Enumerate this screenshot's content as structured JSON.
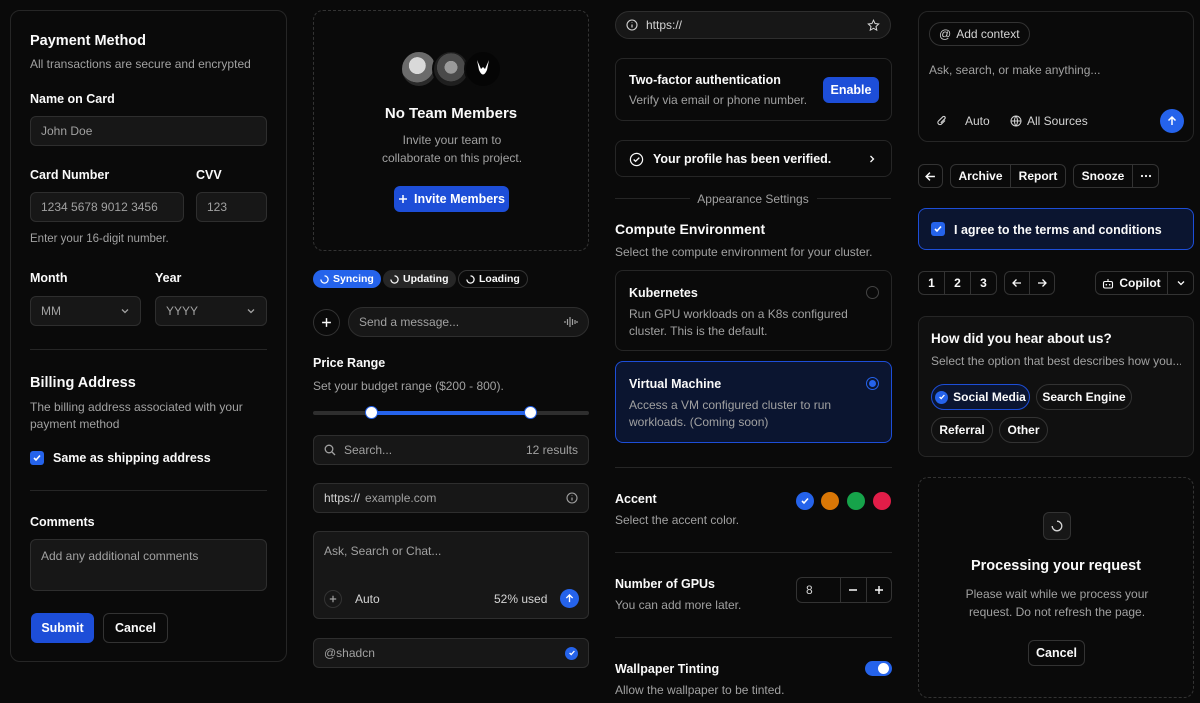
{
  "payment": {
    "title": "Payment Method",
    "subtitle": "All transactions are secure and encrypted",
    "name_label": "Name on Card",
    "name_placeholder": "John Doe",
    "card_label": "Card Number",
    "card_placeholder": "1234 5678 9012 3456",
    "cvv_label": "CVV",
    "cvv_placeholder": "123",
    "card_hint": "Enter your 16-digit number.",
    "month_label": "Month",
    "month_value": "MM",
    "year_label": "Year",
    "year_value": "YYYY",
    "billing_title": "Billing Address",
    "billing_desc": "The billing address associated with your payment method",
    "same_shipping": "Same as shipping address",
    "comments_label": "Comments",
    "comments_placeholder": "Add any additional comments",
    "submit": "Submit",
    "cancel": "Cancel"
  },
  "team": {
    "title": "No Team Members",
    "desc": "Invite your team to collaborate on this project.",
    "invite": "Invite Members"
  },
  "badges": [
    "Syncing",
    "Updating",
    "Loading"
  ],
  "message": {
    "placeholder": "Send a message..."
  },
  "price": {
    "title": "Price Range",
    "desc": "Set your budget range ($200 - 800).",
    "min_fraction": 0.2,
    "max_fraction": 0.8
  },
  "search": {
    "placeholder": "Search...",
    "results": "12 results"
  },
  "url_input": {
    "prefix": "https://",
    "placeholder": "example.com"
  },
  "chat": {
    "placeholder": "Ask, Search or Chat...",
    "mode": "Auto",
    "usage": "52% used"
  },
  "username": {
    "value": "@shadcn"
  },
  "browser": {
    "url": "https://"
  },
  "twofa": {
    "title": "Two-factor authentication",
    "desc": "Verify via email or phone number.",
    "button": "Enable"
  },
  "verified": {
    "text": "Your profile has been verified."
  },
  "appearance": {
    "label": "Appearance Settings"
  },
  "compute": {
    "title": "Compute Environment",
    "desc": "Select the compute environment for your cluster.",
    "options": [
      {
        "title": "Kubernetes",
        "desc": "Run GPU workloads on a K8s configured cluster. This is the default."
      },
      {
        "title": "Virtual Machine",
        "desc": "Access a VM configured cluster to run workloads. (Coming soon)"
      }
    ],
    "selected": 1
  },
  "accent": {
    "title": "Accent",
    "desc": "Select the accent color.",
    "colors": [
      "#2563eb",
      "#d97706",
      "#16a34a",
      "#e11d48"
    ]
  },
  "gpus": {
    "title": "Number of GPUs",
    "desc": "You can add more later.",
    "value": "8"
  },
  "wallpaper": {
    "title": "Wallpaper Tinting",
    "desc": "Allow the wallpaper to be tinted.",
    "enabled": true
  },
  "ai": {
    "context": "Add context",
    "placeholder": "Ask, search, or make anything...",
    "mode": "Auto",
    "sources": "All Sources"
  },
  "actions": {
    "archive": "Archive",
    "report": "Report",
    "snooze": "Snooze"
  },
  "terms": {
    "text": "I agree to the terms and conditions"
  },
  "pagination": {
    "pages": [
      "1",
      "2",
      "3"
    ]
  },
  "copilot": {
    "label": "Copilot"
  },
  "survey": {
    "title": "How did you hear about us?",
    "desc": "Select the option that best describes how you...",
    "options": [
      "Social Media",
      "Search Engine",
      "Referral",
      "Other"
    ],
    "selected": 0
  },
  "processing": {
    "title": "Processing your request",
    "desc": "Please wait while we process your request. Do not refresh the page.",
    "cancel": "Cancel"
  }
}
